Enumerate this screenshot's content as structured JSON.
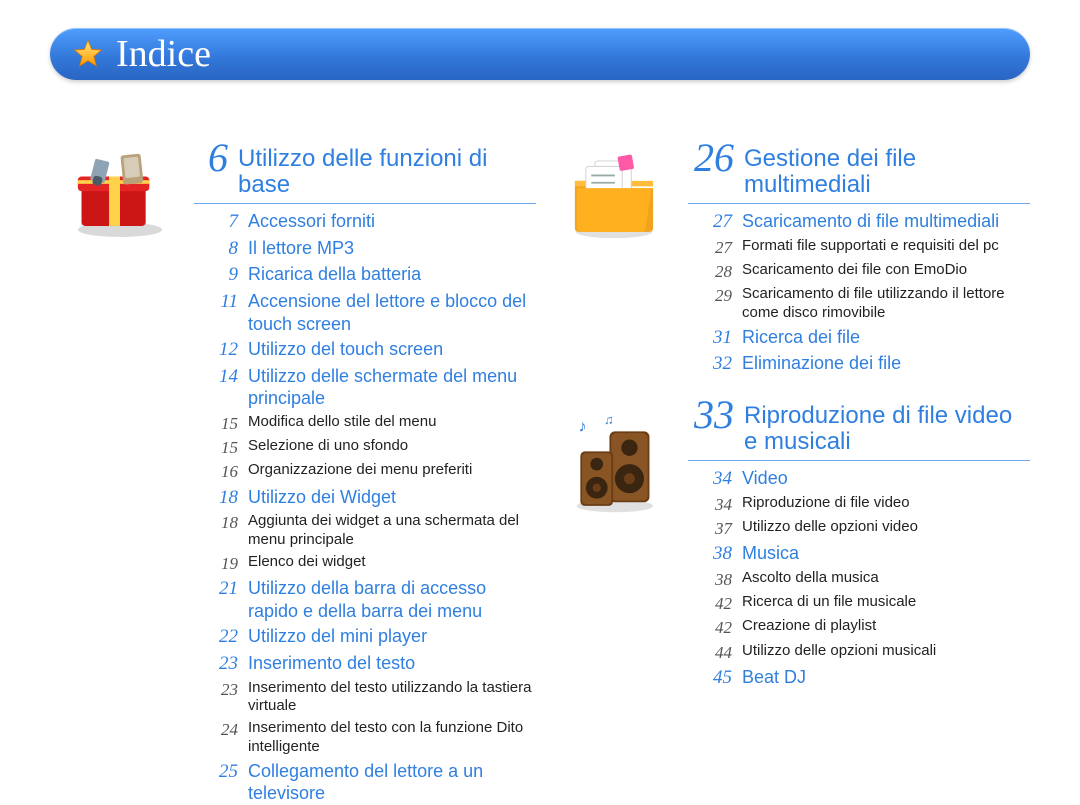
{
  "page_title": "Indice",
  "left_section": {
    "num": "6",
    "title": "Utilizzo delle funzioni di base",
    "entries": [
      {
        "n": "7",
        "t": "Accessori forniti",
        "level": 1,
        "link": true
      },
      {
        "n": "8",
        "t": "Il lettore MP3",
        "level": 1,
        "link": true
      },
      {
        "n": "9",
        "t": "Ricarica della batteria",
        "level": 1,
        "link": true
      },
      {
        "n": "11",
        "t": "Accensione del lettore e blocco del touch screen",
        "level": 1,
        "link": true
      },
      {
        "n": "12",
        "t": "Utilizzo del touch screen",
        "level": 1,
        "link": true
      },
      {
        "n": "14",
        "t": "Utilizzo delle schermate del menu principale",
        "level": 1,
        "link": true
      },
      {
        "n": "15",
        "t": "Modifica dello stile del menu",
        "level": 2,
        "link": false
      },
      {
        "n": "15",
        "t": "Selezione di uno sfondo",
        "level": 2,
        "link": false
      },
      {
        "n": "16",
        "t": "Organizzazione dei menu preferiti",
        "level": 2,
        "link": false
      },
      {
        "n": "18",
        "t": "Utilizzo dei Widget",
        "level": 1,
        "link": true
      },
      {
        "n": "18",
        "t": "Aggiunta dei widget a una schermata del menu principale",
        "level": 2,
        "link": false
      },
      {
        "n": "19",
        "t": "Elenco dei widget",
        "level": 2,
        "link": false
      },
      {
        "n": "21",
        "t": "Utilizzo della barra di accesso rapido e della barra dei menu",
        "level": 1,
        "link": true
      },
      {
        "n": "22",
        "t": "Utilizzo del mini player",
        "level": 1,
        "link": true
      },
      {
        "n": "23",
        "t": "Inserimento del testo",
        "level": 1,
        "link": true
      },
      {
        "n": "23",
        "t": "Inserimento del testo utilizzando la tastiera virtuale",
        "level": 2,
        "link": false
      },
      {
        "n": "24",
        "t": "Inserimento del testo con la funzione Dito intelligente",
        "level": 2,
        "link": false
      },
      {
        "n": "25",
        "t": "Collegamento del lettore a un televisore",
        "level": 1,
        "link": true
      }
    ]
  },
  "right_sections": [
    {
      "num": "26",
      "title": "Gestione dei file multimediali",
      "icon": "folder",
      "entries": [
        {
          "n": "27",
          "t": "Scaricamento di file multimediali",
          "level": 1,
          "link": true
        },
        {
          "n": "27",
          "t": "Formati file supportati e requisiti del pc",
          "level": 2,
          "link": false
        },
        {
          "n": "28",
          "t": "Scaricamento dei file con EmoDio",
          "level": 2,
          "link": false
        },
        {
          "n": "29",
          "t": "Scaricamento di file utilizzando il lettore come disco rimovibile",
          "level": 2,
          "link": false
        },
        {
          "n": "31",
          "t": "Ricerca dei file",
          "level": 1,
          "link": true
        },
        {
          "n": "32",
          "t": "Eliminazione dei file",
          "level": 1,
          "link": true
        }
      ]
    },
    {
      "num": "33",
      "title": "Riproduzione di file video e musicali",
      "icon": "speakers",
      "entries": [
        {
          "n": "34",
          "t": "Video",
          "level": 1,
          "link": true
        },
        {
          "n": "34",
          "t": "Riproduzione di file video",
          "level": 2,
          "link": false
        },
        {
          "n": "37",
          "t": "Utilizzo delle opzioni video",
          "level": 2,
          "link": false
        },
        {
          "n": "38",
          "t": "Musica",
          "level": 1,
          "link": true
        },
        {
          "n": "38",
          "t": "Ascolto della musica",
          "level": 2,
          "link": false
        },
        {
          "n": "42",
          "t": "Ricerca di un file musicale",
          "level": 2,
          "link": false
        },
        {
          "n": "42",
          "t": "Creazione di playlist",
          "level": 2,
          "link": false
        },
        {
          "n": "44",
          "t": "Utilizzo delle opzioni musicali",
          "level": 2,
          "link": false
        },
        {
          "n": "45",
          "t": "Beat DJ",
          "level": 1,
          "link": true
        }
      ]
    }
  ]
}
